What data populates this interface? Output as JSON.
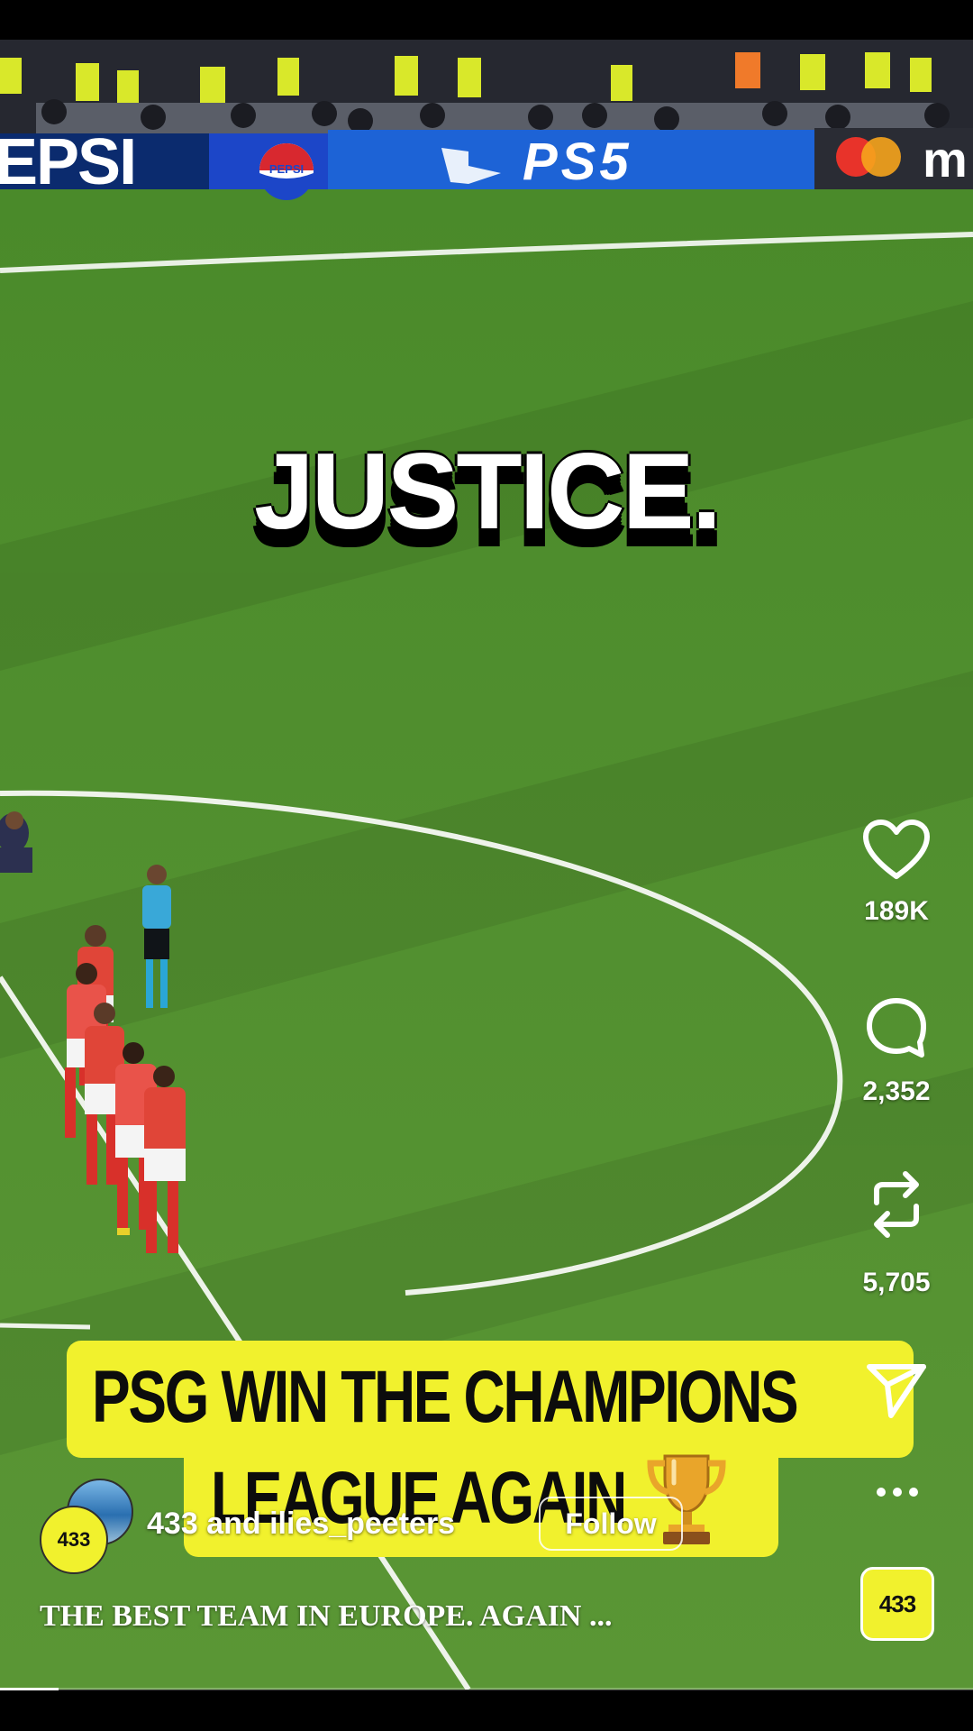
{
  "video": {
    "overlay_caption": "JUSTICE.",
    "ad_boards": [
      "EPSI",
      "PEPSI",
      "PS5",
      "m"
    ],
    "banner": {
      "line1": "PSG WIN THE CHAMPIONS",
      "line2": "LEAGUE AGAIN",
      "emoji": "trophy-icon",
      "background_color": "#f1f12d"
    },
    "progress": 0.06
  },
  "actions": {
    "like": {
      "icon": "heart-icon",
      "count": "189K"
    },
    "comment": {
      "icon": "comment-icon",
      "count": "2,352"
    },
    "repost": {
      "icon": "repost-icon",
      "count": "5,705"
    },
    "share": {
      "icon": "send-icon"
    },
    "more": {
      "icon": "more-icon"
    }
  },
  "author": {
    "names": "433 and ilies_peeters",
    "avatar_badge": "433",
    "follow_label": "Follow"
  },
  "post": {
    "caption": "THE BEST TEAM IN EUROPE. AGAIN ..."
  },
  "brand_badge": "433",
  "colors": {
    "accent_yellow": "#f1f12d",
    "pitch_green": "#4f8c2c",
    "text": "#ffffff"
  }
}
